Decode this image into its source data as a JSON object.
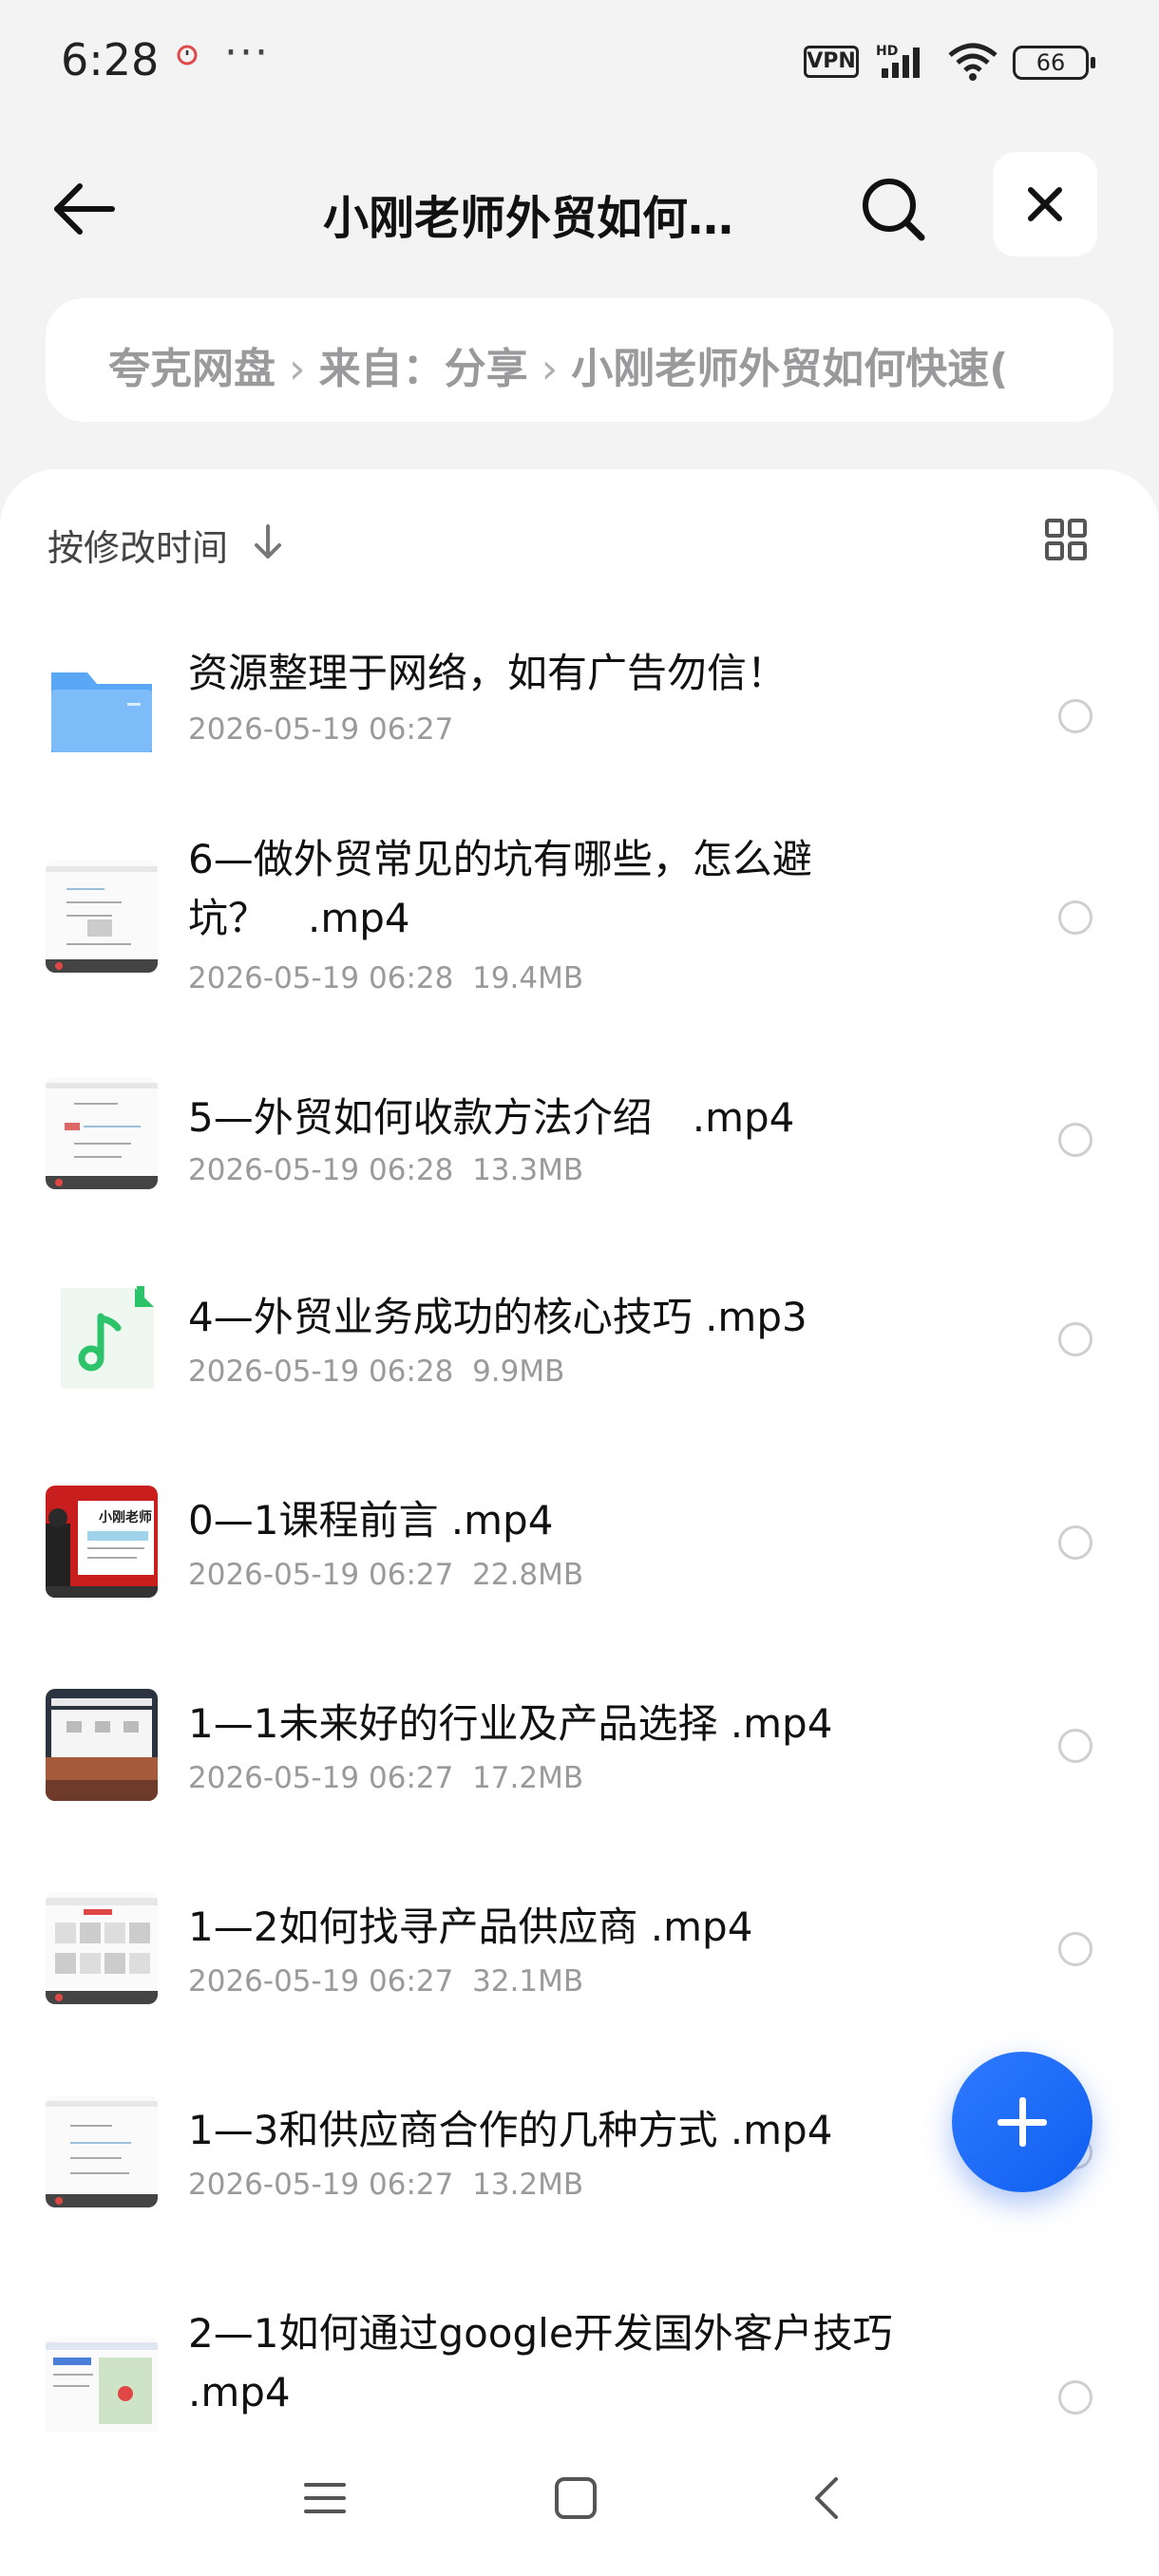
{
  "status": {
    "time": "6:28",
    "dots": "···",
    "vpn": "VPN",
    "battery": "66"
  },
  "header": {
    "title": "小刚老师外贸如何…"
  },
  "breadcrumb": {
    "items": [
      "夸克网盘",
      "来自：分享",
      "小刚老师外贸如何快速("
    ],
    "sep": "›"
  },
  "sort": {
    "label": "按修改时间"
  },
  "files": [
    {
      "name": "资源整理于网络，如有广告勿信！",
      "date": "2026-05-19 06:27",
      "size": "",
      "kind": "folder-icon"
    },
    {
      "name": "6—做外贸常见的坑有哪些，怎么避坑？　.mp4",
      "date": "2026-05-19 06:28",
      "size": "19.4MB",
      "kind": "video-thumbnail"
    },
    {
      "name": "5—外贸如何收款方法介绍　.mp4",
      "date": "2026-05-19 06:28",
      "size": "13.3MB",
      "kind": "video-thumbnail"
    },
    {
      "name": "4—外贸业务成功的核心技巧 .mp3",
      "date": "2026-05-19 06:28",
      "size": "9.9MB",
      "kind": "music-icon"
    },
    {
      "name": "0—1课程前言 .mp4",
      "date": "2026-05-19 06:27",
      "size": "22.8MB",
      "kind": "video-thumbnail"
    },
    {
      "name": "1—1未来好的行业及产品选择 .mp4",
      "date": "2026-05-19 06:27",
      "size": "17.2MB",
      "kind": "video-thumbnail"
    },
    {
      "name": "1—2如何找寻产品供应商 .mp4",
      "date": "2026-05-19 06:27",
      "size": "32.1MB",
      "kind": "video-thumbnail"
    },
    {
      "name": "1—3和供应商合作的几种方式 .mp4",
      "date": "2026-05-19 06:27",
      "size": "13.2MB",
      "kind": "video-thumbnail"
    },
    {
      "name": "2—1如何通过google开发国外客户技巧 .mp4",
      "date": "",
      "size": "",
      "kind": "video-thumbnail"
    }
  ],
  "thumb_text": {
    "teacher": "小刚老师"
  },
  "colors": {
    "accent": "#1e6cf7",
    "folder": "#5aa7f5",
    "music": "#2cc36b"
  }
}
